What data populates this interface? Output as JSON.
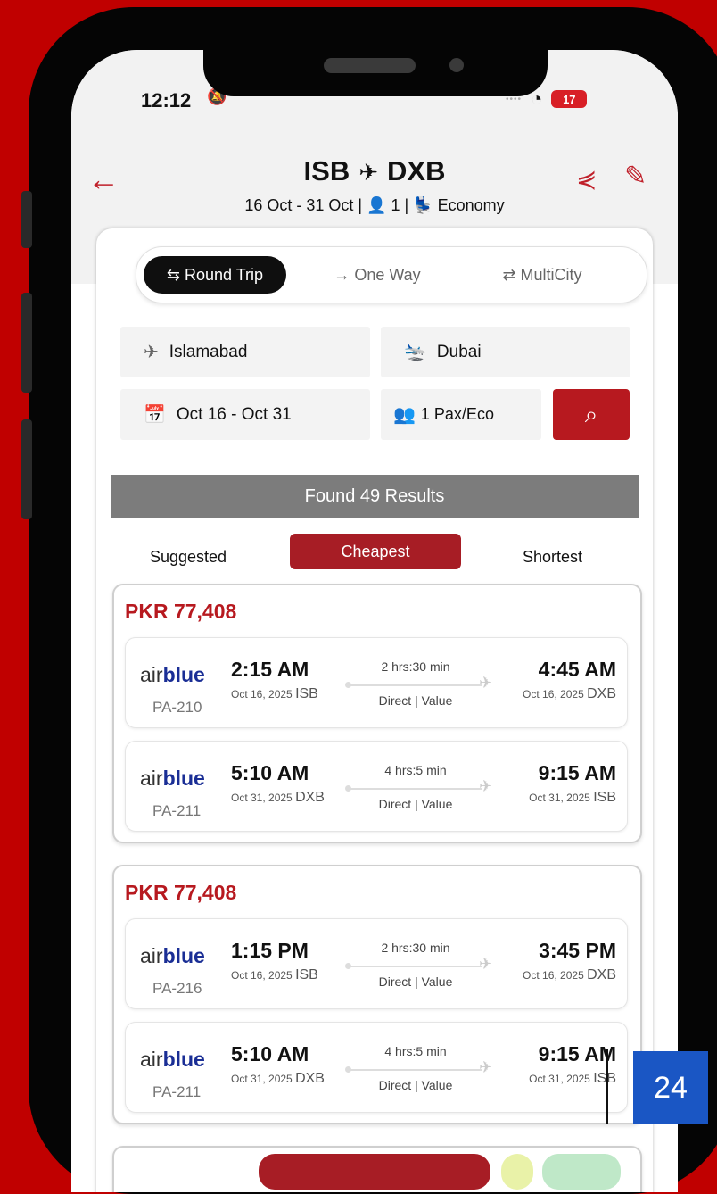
{
  "status_bar": {
    "time": "12:12",
    "battery": "17"
  },
  "header": {
    "origin": "ISB",
    "destination": "DXB",
    "dates": "16 Oct - 31 Oct",
    "passengers": "1",
    "cabin": "Economy"
  },
  "trip_tabs": {
    "round_trip": "Round Trip",
    "one_way": "One Way",
    "multi_city": "MultiCity",
    "selected": "Round Trip"
  },
  "search_form": {
    "from": "Islamabad",
    "to": "Dubai",
    "dates": "Oct 16 - Oct 31",
    "pax": "1 Pax/Eco"
  },
  "results": {
    "count_text": "Found 49 Results"
  },
  "sort_tabs": {
    "suggested": "Suggested",
    "cheapest": "Cheapest",
    "shortest": "Shortest",
    "selected": "Cheapest"
  },
  "offers": [
    {
      "price": "PKR 77,408",
      "legs": [
        {
          "airline_a": "air",
          "airline_b": "blue",
          "flight_no": "PA-210",
          "dep_time": "2:15 AM",
          "dep_date": "Oct 16, 2025",
          "dep_code": "ISB",
          "duration": "2 hrs:30 min",
          "stops": "Direct | Value",
          "arr_time": "4:45 AM",
          "arr_date": "Oct 16, 2025",
          "arr_code": "DXB"
        },
        {
          "airline_a": "air",
          "airline_b": "blue",
          "flight_no": "PA-211",
          "dep_time": "5:10 AM",
          "dep_date": "Oct 31, 2025",
          "dep_code": "DXB",
          "duration": "4 hrs:5 min",
          "stops": "Direct | Value",
          "arr_time": "9:15 AM",
          "arr_date": "Oct 31, 2025",
          "arr_code": "ISB"
        }
      ]
    },
    {
      "price": "PKR 77,408",
      "legs": [
        {
          "airline_a": "air",
          "airline_b": "blue",
          "flight_no": "PA-216",
          "dep_time": "1:15 PM",
          "dep_date": "Oct 16, 2025",
          "dep_code": "ISB",
          "duration": "2 hrs:30 min",
          "stops": "Direct | Value",
          "arr_time": "3:45 PM",
          "arr_date": "Oct 16, 2025",
          "arr_code": "DXB"
        },
        {
          "airline_a": "air",
          "airline_b": "blue",
          "flight_no": "PA-211",
          "dep_time": "5:10 AM",
          "dep_date": "Oct 31, 2025",
          "dep_code": "DXB",
          "duration": "4 hrs:5 min",
          "stops": "Direct | Value",
          "arr_time": "9:15 AM",
          "arr_date": "Oct 31, 2025",
          "arr_code": "ISB"
        }
      ]
    }
  ],
  "page_badge": "24",
  "colors": {
    "brand_red": "#b7191f",
    "background_red": "#c00000",
    "airline_blue": "#1a2e95",
    "badge_blue": "#1a56c4"
  }
}
